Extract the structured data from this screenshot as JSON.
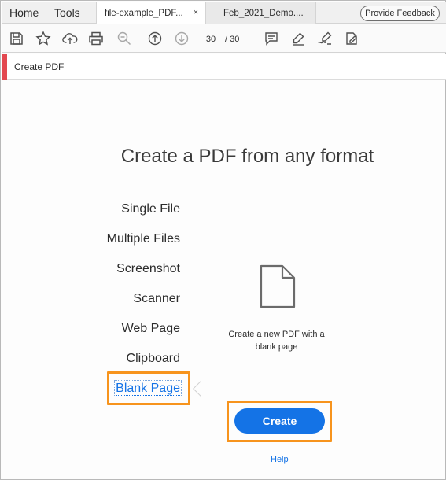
{
  "menu": {
    "home": "Home",
    "tools": "Tools"
  },
  "tabs": [
    {
      "label": "file-example_PDF...",
      "close": "×",
      "active": true
    },
    {
      "label": "Feb_2021_Demo....",
      "active": false
    }
  ],
  "feedback_button": "Provide Feedback",
  "toolbar": {
    "icons": [
      "save-icon",
      "star-icon",
      "cloud-upload-icon",
      "print-icon",
      "zoom-icon",
      "page-up-icon",
      "page-down-icon",
      "comment-icon",
      "highlight-pen-icon",
      "sign-icon",
      "edit-icon"
    ],
    "page_current": "30",
    "page_total": "/ 30"
  },
  "tool_header": {
    "title": "Create PDF",
    "accent_color": "#e34850"
  },
  "main": {
    "heading": "Create a PDF from any format",
    "options": [
      "Single File",
      "Multiple Files",
      "Screenshot",
      "Scanner",
      "Web Page",
      "Clipboard",
      "Blank Page"
    ],
    "selected_option": "Blank Page",
    "description": "Create a new PDF with a blank page",
    "create_button": "Create",
    "help_link": "Help"
  },
  "colors": {
    "accent_blue": "#1473e6",
    "highlight_orange": "#f7941d"
  }
}
